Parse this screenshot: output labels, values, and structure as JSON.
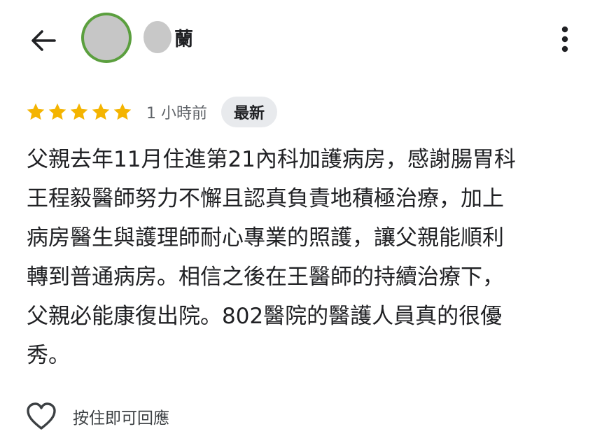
{
  "header": {
    "back_icon": "arrow-left-icon",
    "menu_icon": "more-vert-icon",
    "avatar_ring_color": "#5b9f3e",
    "reviewer_name_visible": "蘭"
  },
  "rating": {
    "stars": 5,
    "max_stars": 5,
    "star_color": "#f4b400",
    "time_ago": "1 小時前",
    "badge": "最新"
  },
  "review": {
    "lines": [
      "父親去年11月住進第21內科加護病房，感謝腸胃科",
      "王程毅醫師努力不懈且認真負責地積極治療，加上",
      "病房醫生與護理師耐心專業的照護，讓父親能順利",
      "轉到普通病房。相信之後在王醫師的持續治療下，",
      "父親必能康復出院。802醫院的醫護人員真的很優",
      "秀。"
    ]
  },
  "footer": {
    "heart_icon": "heart-outline-icon",
    "reply_hint": "按住即可回應"
  }
}
